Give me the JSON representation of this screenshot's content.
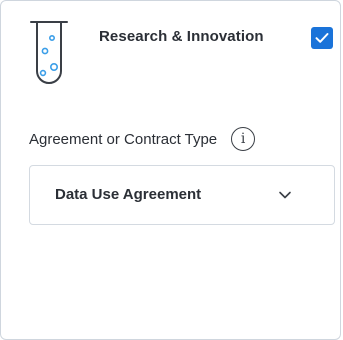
{
  "option": {
    "title": "Research & Innovation",
    "icon": "test-tube-icon",
    "checked": true
  },
  "field": {
    "label": "Agreement or Contract Type",
    "info_icon": "info-icon",
    "info_glyph": "i",
    "selected_value": "Data Use Agreement",
    "dropdown_icon": "chevron-down-icon"
  },
  "colors": {
    "accent": "#1a73d9",
    "border": "#cfd6de",
    "text": "#2b2f36",
    "tube_fill": "#3b9ee8"
  }
}
